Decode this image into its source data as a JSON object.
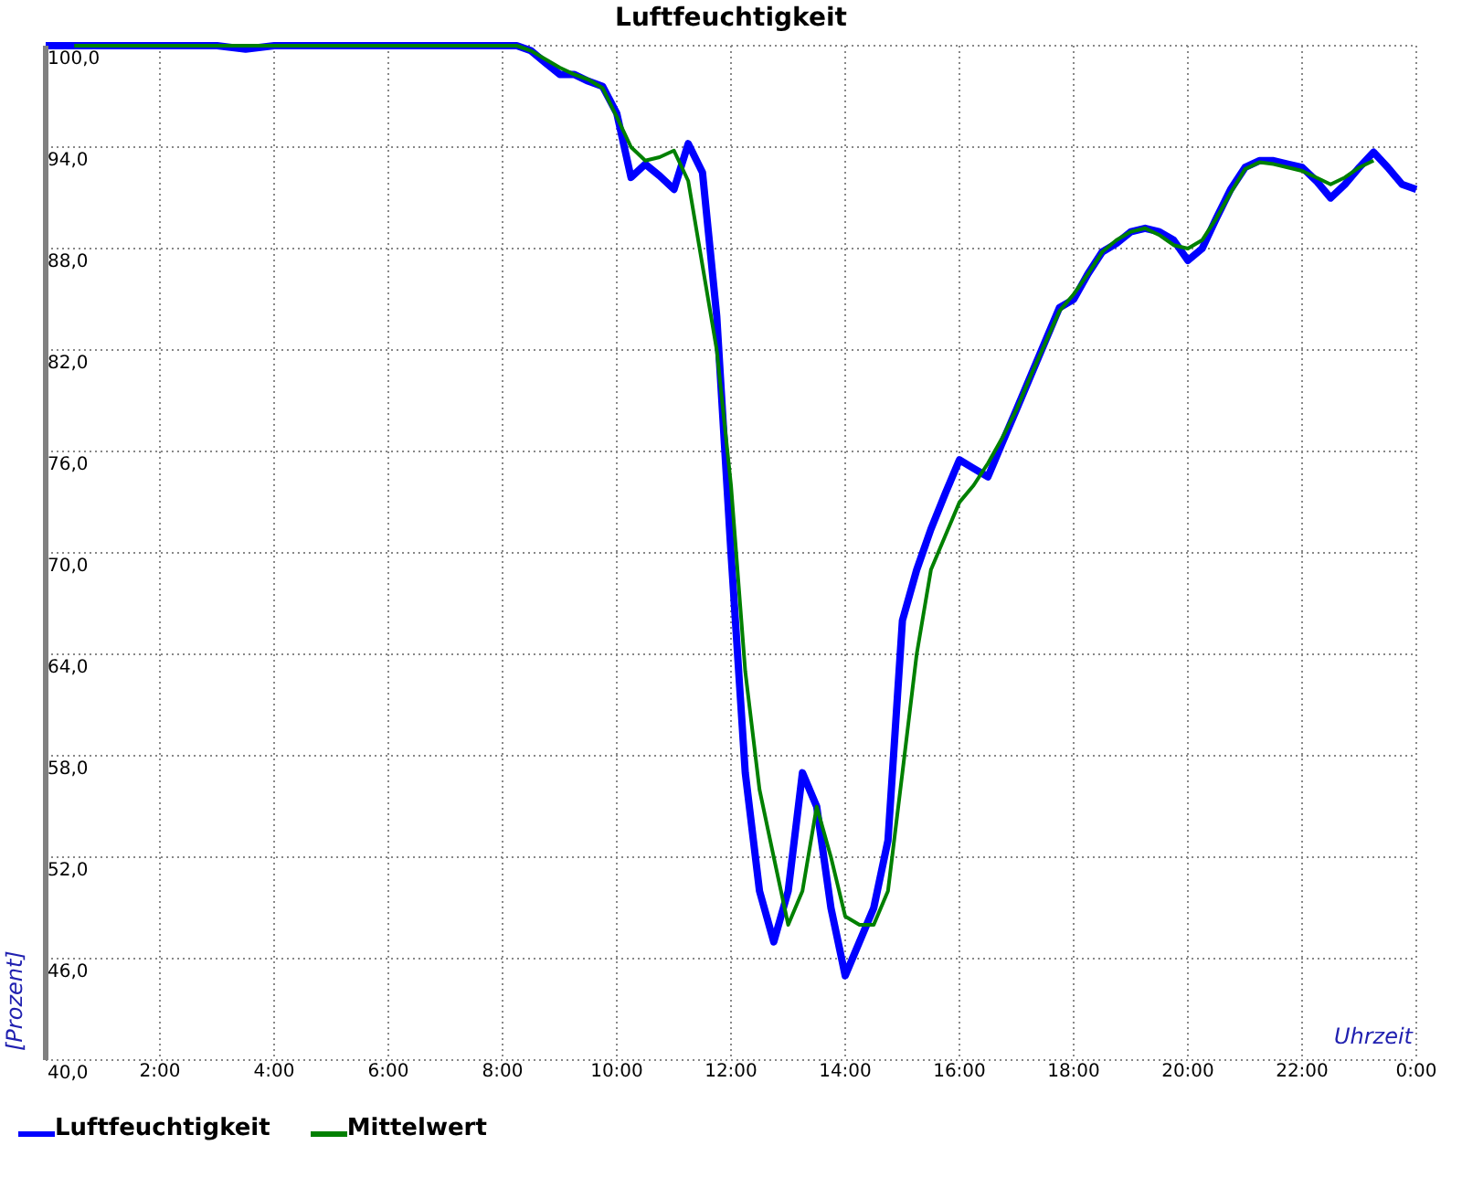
{
  "chart_data": {
    "type": "line",
    "title": "Luftfeuchtigkeit",
    "xlabel": "Uhrzeit",
    "ylabel": "[Prozent]",
    "x": [
      0,
      0.5,
      1,
      1.5,
      2,
      2.5,
      3,
      3.5,
      4,
      4.5,
      5,
      5.5,
      6,
      6.5,
      7,
      7.5,
      8,
      8.25,
      8.5,
      8.75,
      9,
      9.25,
      9.5,
      9.75,
      10,
      10.25,
      10.5,
      10.75,
      11,
      11.25,
      11.5,
      11.75,
      12,
      12.25,
      12.5,
      12.75,
      13,
      13.25,
      13.5,
      13.75,
      14,
      14.25,
      14.5,
      14.75,
      15,
      15.25,
      15.5,
      15.75,
      16,
      16.25,
      16.5,
      16.75,
      17,
      17.25,
      17.5,
      17.75,
      18,
      18.25,
      18.5,
      18.75,
      19,
      19.25,
      19.5,
      19.75,
      20,
      20.25,
      20.5,
      20.75,
      21,
      21.25,
      21.5,
      21.75,
      22,
      22.25,
      22.5,
      22.75,
      23,
      23.25,
      23.5,
      23.75,
      24
    ],
    "series": [
      {
        "name": "Luftfeuchtigkeit",
        "color": "#0000ff",
        "values": [
          100,
          100,
          100,
          100,
          100,
          100,
          100,
          99.8,
          100,
          100,
          100,
          100,
          100,
          100,
          100,
          100,
          100,
          100,
          99.7,
          99,
          98.3,
          98.3,
          97.9,
          97.6,
          96,
          92.2,
          93,
          92.3,
          91.5,
          94.2,
          92.5,
          84,
          70,
          57,
          50,
          47,
          50,
          57,
          55,
          49,
          45,
          47,
          49,
          53,
          66,
          69,
          71.4,
          73.5,
          75.5,
          75,
          74.5,
          76.5,
          78.5,
          80.5,
          82.5,
          84.5,
          85,
          86.5,
          87.8,
          88.3,
          89,
          89.2,
          89,
          88.5,
          87.3,
          88,
          89.8,
          91.5,
          92.8,
          93.2,
          93.2,
          93,
          92.8,
          92,
          91,
          91.8,
          92.8,
          93.7,
          92.8,
          91.8,
          91.5
        ]
      },
      {
        "name": "Mittelwert",
        "color": "#008000",
        "values": [
          null,
          100,
          100,
          100,
          100,
          100,
          100,
          100,
          100,
          100,
          100,
          100,
          100,
          100,
          100,
          100,
          100,
          100,
          99.7,
          99.2,
          98.7,
          98.3,
          98,
          97.5,
          95.8,
          94,
          93.2,
          93.4,
          93.8,
          92,
          87,
          82,
          74,
          63,
          56,
          52,
          48,
          50,
          55,
          52,
          48.5,
          48,
          48,
          50,
          57,
          64,
          69,
          71,
          73,
          74,
          75.3,
          76.8,
          78.5,
          80.5,
          82.4,
          84.3,
          85.3,
          86.5,
          87.8,
          88.5,
          89,
          89.2,
          88.8,
          88.2,
          88,
          88.5,
          89.8,
          91.3,
          92.7,
          93.1,
          93,
          92.8,
          92.6,
          92.2,
          91.8,
          92.2,
          92.8,
          93.2,
          null,
          null,
          null
        ]
      }
    ],
    "xlim": [
      0,
      24
    ],
    "ylim": [
      40,
      100
    ],
    "grid": true,
    "legend": "bottom-left",
    "xticks": [
      {
        "value": 2,
        "label": "2:00"
      },
      {
        "value": 4,
        "label": "4:00"
      },
      {
        "value": 6,
        "label": "6:00"
      },
      {
        "value": 8,
        "label": "8:00"
      },
      {
        "value": 10,
        "label": "10:00"
      },
      {
        "value": 12,
        "label": "12:00"
      },
      {
        "value": 14,
        "label": "14:00"
      },
      {
        "value": 16,
        "label": "16:00"
      },
      {
        "value": 18,
        "label": "18:00"
      },
      {
        "value": 20,
        "label": "20:00"
      },
      {
        "value": 22,
        "label": "22:00"
      },
      {
        "value": 24,
        "label": "0:00"
      }
    ],
    "yticks": [
      {
        "value": 40,
        "label": "40,0"
      },
      {
        "value": 46,
        "label": "46,0"
      },
      {
        "value": 52,
        "label": "52,0"
      },
      {
        "value": 58,
        "label": "58,0"
      },
      {
        "value": 64,
        "label": "64,0"
      },
      {
        "value": 70,
        "label": "70,0"
      },
      {
        "value": 76,
        "label": "76,0"
      },
      {
        "value": 82,
        "label": "82,0"
      },
      {
        "value": 88,
        "label": "88,0"
      },
      {
        "value": 94,
        "label": "94,0"
      },
      {
        "value": 100,
        "label": "100,0"
      }
    ]
  }
}
